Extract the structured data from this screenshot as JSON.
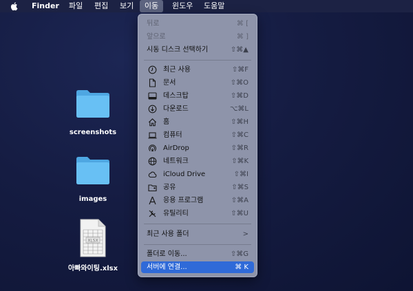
{
  "menubar": {
    "app_name": "Finder",
    "items": [
      "파일",
      "편집",
      "보기",
      "이동",
      "윈도우",
      "도움말"
    ],
    "active": "이동"
  },
  "desktop": {
    "icons": [
      {
        "label": "screenshots",
        "icon": "folder-icon"
      },
      {
        "label": "images",
        "icon": "folder-icon"
      },
      {
        "label": "아빠와이팅.xlsx",
        "icon": "spreadsheet-file-icon"
      }
    ]
  },
  "menu": {
    "title": "이동",
    "top_items": [
      {
        "label": "뒤로",
        "shortcut": "⌘ [",
        "disabled": true
      },
      {
        "label": "앞으로",
        "shortcut": "⌘ ]",
        "disabled": true
      },
      {
        "label": "시동 디스크 선택하기",
        "shortcut": "⇧⌘▲"
      }
    ],
    "places": [
      {
        "label": "최근 사용",
        "shortcut": "⇧⌘F",
        "icon": "clock-icon"
      },
      {
        "label": "문서",
        "shortcut": "⇧⌘O",
        "icon": "document-icon"
      },
      {
        "label": "데스크탑",
        "shortcut": "⇧⌘D",
        "icon": "desktop-icon"
      },
      {
        "label": "다운로드",
        "shortcut": "⌥⌘L",
        "icon": "download-icon"
      },
      {
        "label": "홈",
        "shortcut": "⇧⌘H",
        "icon": "home-icon"
      },
      {
        "label": "컴퓨터",
        "shortcut": "⇧⌘C",
        "icon": "laptop-icon"
      },
      {
        "label": "AirDrop",
        "shortcut": "⇧⌘R",
        "icon": "airdrop-icon"
      },
      {
        "label": "네트워크",
        "shortcut": "⇧⌘K",
        "icon": "globe-icon"
      },
      {
        "label": "iCloud Drive",
        "shortcut": "⇧⌘I",
        "icon": "cloud-icon"
      },
      {
        "label": "공유",
        "shortcut": "⇧⌘S",
        "icon": "shared-folder-icon"
      },
      {
        "label": "응용 프로그램",
        "shortcut": "⇧⌘A",
        "icon": "applications-icon"
      },
      {
        "label": "유틸리티",
        "shortcut": "⇧⌘U",
        "icon": "utilities-icon"
      }
    ],
    "recent_folders": {
      "label": "최근 사용 폴더",
      "shortcut": ">"
    },
    "bottom_items": [
      {
        "label": "폴더로 이동...",
        "shortcut": "⇧⌘G"
      },
      {
        "label": "서버에 연결...",
        "shortcut": "⌘ K",
        "highlighted": true
      }
    ]
  },
  "colors": {
    "menu_background": "#8e94aa",
    "highlight": "#2f6ad8",
    "folder": "#5bb8f0"
  }
}
